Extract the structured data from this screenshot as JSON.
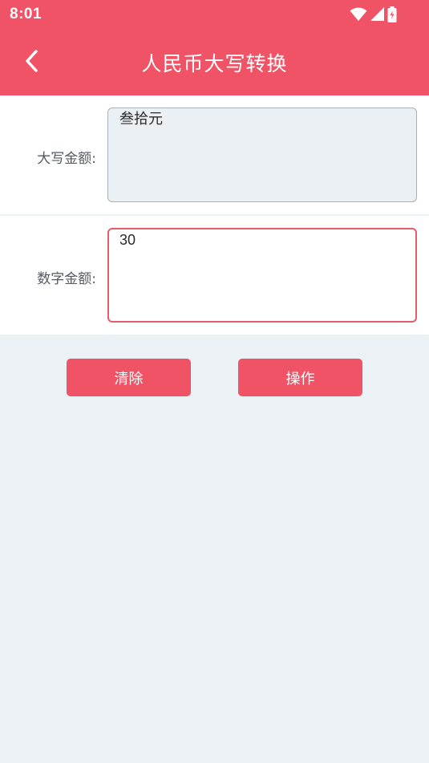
{
  "status_bar": {
    "time": "8:01",
    "icons": [
      "wifi-icon",
      "cellular-signal-icon",
      "battery-charging-icon"
    ]
  },
  "toolbar": {
    "title": "人民币大写转换",
    "back_icon": "chevron-left-icon"
  },
  "form": {
    "uppercase_label": "大写金额:",
    "uppercase_value": "叁拾元",
    "number_label": "数字金额:",
    "number_value": "30"
  },
  "actions": {
    "clear_label": "清除",
    "operate_label": "操作"
  },
  "colors": {
    "accent": "#f05365",
    "background": "#ecf1f6",
    "input_border": "#e75c6c"
  }
}
